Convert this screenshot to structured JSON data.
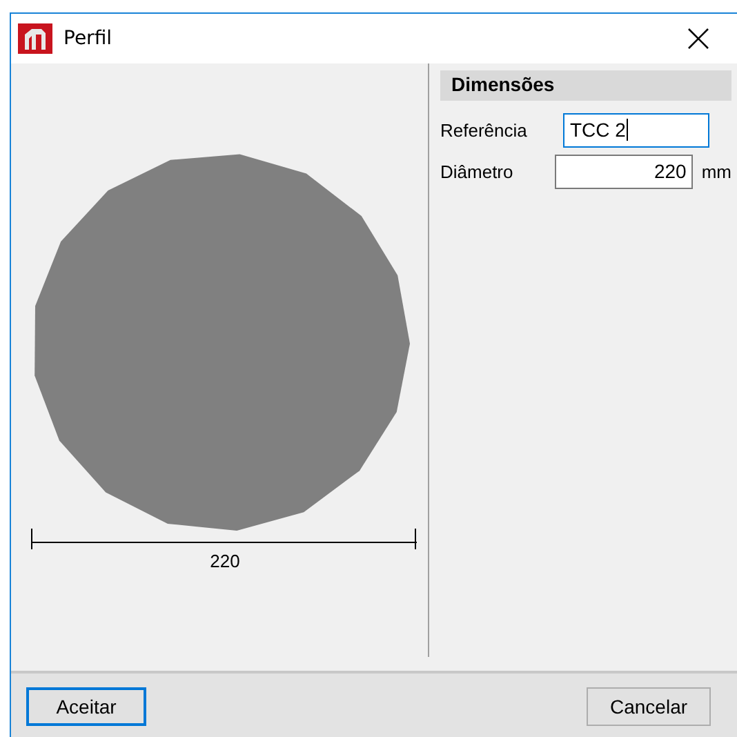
{
  "window": {
    "title": "Perfil"
  },
  "drawing": {
    "dimension_label": "220"
  },
  "panel": {
    "heading": "Dimensões",
    "fields": [
      {
        "label": "Referência",
        "value": "TCC 2",
        "kind": "text",
        "focused": true
      },
      {
        "label": "Diâmetro",
        "value": "220",
        "unit": "mm",
        "kind": "number",
        "focused": false
      }
    ]
  },
  "buttons": [
    {
      "label": "Aceitar",
      "default": true
    },
    {
      "label": "Cancelar",
      "default": false
    }
  ]
}
